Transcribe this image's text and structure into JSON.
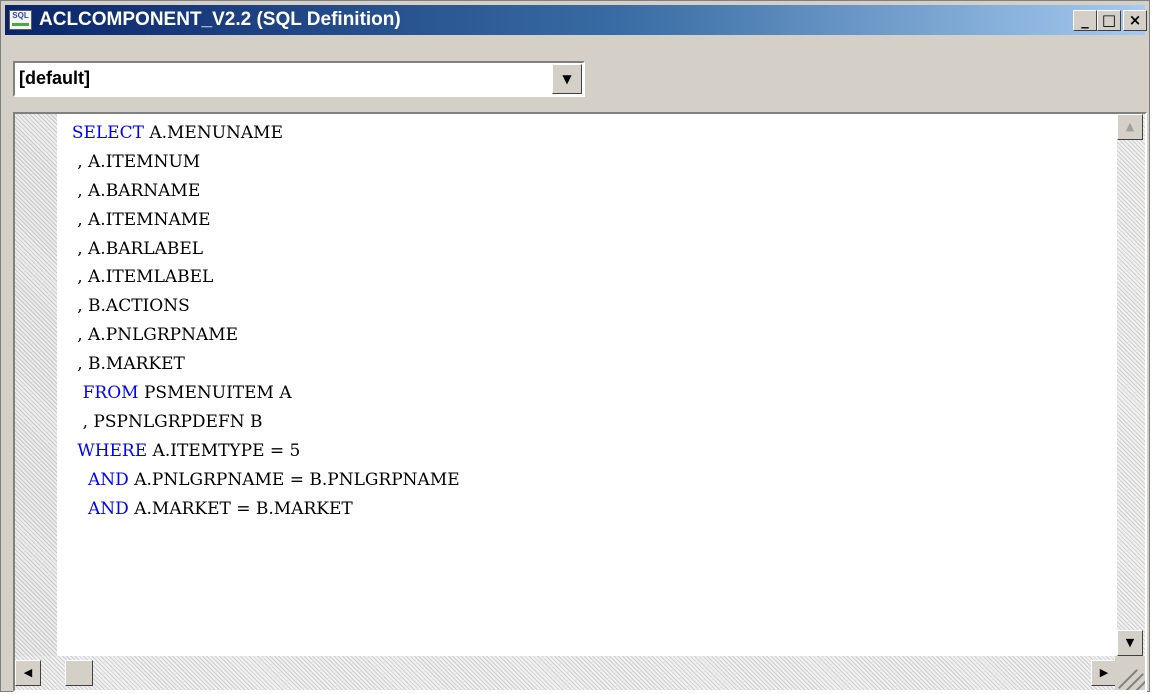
{
  "window": {
    "title": "ACLCOMPONENT_V2.2 (SQL Definition)",
    "app_icon_text": "SQL",
    "buttons": {
      "minimize": "_",
      "maximize": "□",
      "close": "×"
    }
  },
  "dropdown": {
    "selected": "[default]",
    "arrow": "▼"
  },
  "editor": {
    "lines": [
      [
        {
          "t": "  ",
          "k": false
        },
        {
          "t": "SELECT",
          "k": true
        },
        {
          "t": " A.MENUNAME",
          "k": false
        }
      ],
      [
        {
          "t": "   , A.ITEMNUM",
          "k": false
        }
      ],
      [
        {
          "t": "   , A.BARNAME",
          "k": false
        }
      ],
      [
        {
          "t": "   , A.ITEMNAME",
          "k": false
        }
      ],
      [
        {
          "t": "   , A.BARLABEL",
          "k": false
        }
      ],
      [
        {
          "t": "   , A.ITEMLABEL",
          "k": false
        }
      ],
      [
        {
          "t": "   , B.ACTIONS",
          "k": false
        }
      ],
      [
        {
          "t": "   , A.PNLGRPNAME",
          "k": false
        }
      ],
      [
        {
          "t": "   , B.MARKET",
          "k": false
        }
      ],
      [
        {
          "t": "    ",
          "k": false
        },
        {
          "t": "FROM",
          "k": true
        },
        {
          "t": " PSMENUITEM A",
          "k": false
        }
      ],
      [
        {
          "t": "    , PSPNLGRPDEFN B",
          "k": false
        }
      ],
      [
        {
          "t": "   ",
          "k": false
        },
        {
          "t": "WHERE",
          "k": true
        },
        {
          "t": " A.ITEMTYPE = 5",
          "k": false
        }
      ],
      [
        {
          "t": "     ",
          "k": false
        },
        {
          "t": "AND",
          "k": true
        },
        {
          "t": " A.PNLGRPNAME = B.PNLGRPNAME",
          "k": false
        }
      ],
      [
        {
          "t": "     ",
          "k": false
        },
        {
          "t": "AND",
          "k": true
        },
        {
          "t": " A.MARKET = B.MARKET",
          "k": false
        }
      ]
    ]
  },
  "scrollbars": {
    "up": "▲",
    "down": "▼",
    "left": "◀",
    "right": "▶"
  },
  "colors": {
    "keyword": "#0000ff",
    "titlebar_start": "#0a246a",
    "titlebar_end": "#a6caf0"
  }
}
